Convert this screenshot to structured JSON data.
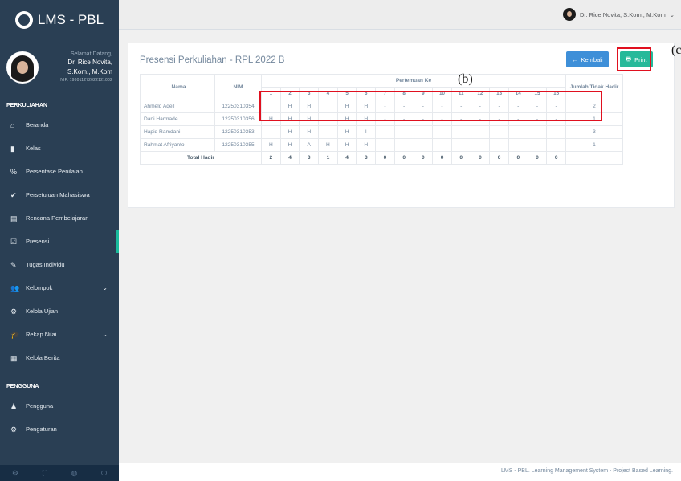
{
  "app": {
    "title": "LMS - PBL"
  },
  "profile": {
    "welcome": "Selamat Datang,",
    "name_line1": "Dr. Rice Novita,",
    "name_line2": "S.Kom., M.Kom",
    "nip": "NIP. 198011272022121002"
  },
  "user_nav": {
    "name": "Dr. Rice Novita, S.Kom., M.Kom"
  },
  "sidebar": {
    "section1": "PERKULIAHAN",
    "items1": [
      {
        "label": "Beranda",
        "icon": "home-icon"
      },
      {
        "label": "Kelas",
        "icon": "book-icon"
      },
      {
        "label": "Persentase Penilaian",
        "icon": "percent-icon"
      },
      {
        "label": "Persetujuan Mahasiswa",
        "icon": "check-circle-icon"
      },
      {
        "label": "Rencana Pembelajaran",
        "icon": "file-icon"
      },
      {
        "label": "Presensi",
        "icon": "check-square-icon"
      },
      {
        "label": "Tugas Individu",
        "icon": "edit-icon"
      },
      {
        "label": "Kelompok",
        "icon": "users-icon"
      },
      {
        "label": "Kelola Ujian",
        "icon": "cogs-icon"
      },
      {
        "label": "Rekap Nilai",
        "icon": "graduation-cap-icon"
      },
      {
        "label": "Kelola Berita",
        "icon": "newspaper-icon"
      }
    ],
    "section2": "PENGGUNA",
    "items2": [
      {
        "label": "Pengguna",
        "icon": "user-icon"
      },
      {
        "label": "Pengaturan",
        "icon": "gear-icon"
      }
    ]
  },
  "panel": {
    "title": "Presensi Perkuliahan - RPL 2022 B",
    "back_label": "Kembali",
    "print_label": "Print",
    "label_b": "(b)",
    "label_c": "(c)"
  },
  "table": {
    "col_nama": "Nama",
    "col_nim": "NIM",
    "col_pertemuan": "Pertemuan Ke",
    "col_jumlah": "Jumlah Tidak Hadir",
    "meetings": [
      "1",
      "2",
      "3",
      "4",
      "5",
      "6",
      "7",
      "8",
      "9",
      "10",
      "11",
      "12",
      "13",
      "14",
      "15",
      "16"
    ],
    "rows": [
      {
        "name": "Ahmeld Aqeil",
        "nim": "12250310354",
        "marks": [
          "I",
          "H",
          "H",
          "I",
          "H",
          "H",
          "-",
          "-",
          "-",
          "-",
          "-",
          "-",
          "-",
          "-",
          "-",
          "-"
        ],
        "absent": "2"
      },
      {
        "name": "Dani Harmade",
        "nim": "12250310356",
        "marks": [
          "H",
          "H",
          "H",
          "I",
          "H",
          "H",
          "-",
          "-",
          "-",
          "-",
          "-",
          "-",
          "-",
          "-",
          "-",
          "-"
        ],
        "absent": "1"
      },
      {
        "name": "Hapid Ramdani",
        "nim": "12250310353",
        "marks": [
          "I",
          "H",
          "H",
          "I",
          "H",
          "I",
          "-",
          "-",
          "-",
          "-",
          "-",
          "-",
          "-",
          "-",
          "-",
          "-"
        ],
        "absent": "3"
      },
      {
        "name": "Rahmat Afriyanto",
        "nim": "12250310355",
        "marks": [
          "H",
          "H",
          "A",
          "H",
          "H",
          "H",
          "-",
          "-",
          "-",
          "-",
          "-",
          "-",
          "-",
          "-",
          "-",
          "-"
        ],
        "absent": "1"
      }
    ],
    "total_label": "Total Hadir",
    "totals": [
      "2",
      "4",
      "3",
      "1",
      "4",
      "3",
      "0",
      "0",
      "0",
      "0",
      "0",
      "0",
      "0",
      "0",
      "0",
      "0"
    ]
  },
  "footer": {
    "text": "LMS - PBL. Learning Management System - Project Based Learning."
  }
}
